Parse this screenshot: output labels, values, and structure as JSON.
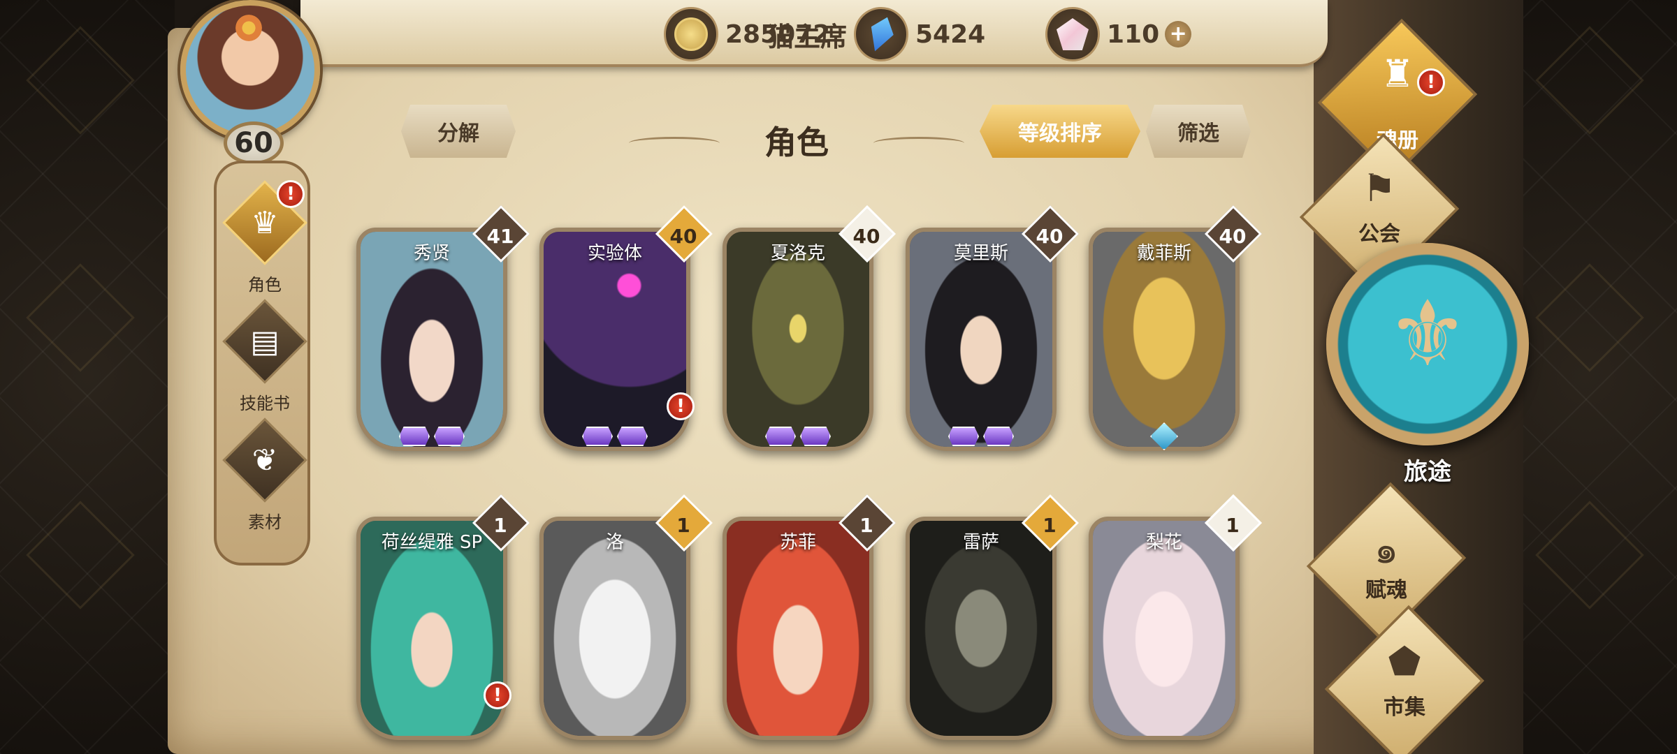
{
  "header": {
    "player_name": "猫主席",
    "player_level": "60",
    "currencies": [
      {
        "icon": "gold-coin-icon",
        "value": "285072"
      },
      {
        "icon": "blue-crystal-icon",
        "value": "5424"
      },
      {
        "icon": "pink-gem-icon",
        "value": "110"
      }
    ],
    "add_label": "+"
  },
  "left_nav": [
    {
      "label": "角色",
      "icon": "character-icon",
      "active": true,
      "alert": "!"
    },
    {
      "label": "技能书",
      "icon": "skill-book-icon",
      "active": false
    },
    {
      "label": "素材",
      "icon": "material-icon",
      "active": false
    }
  ],
  "toolbar": {
    "decompose_label": "分解",
    "title": "角色",
    "sort_label": "等级排序",
    "filter_label": "筛选"
  },
  "cards_row1": [
    {
      "name": "秀贤",
      "level": "41",
      "level_color": "#5a4535",
      "alert": ""
    },
    {
      "name": "实验体",
      "level": "40",
      "level_color": "#e4a93a",
      "alert": "!"
    },
    {
      "name": "夏洛克",
      "level": "40",
      "level_color": "#ffffff",
      "alert": ""
    },
    {
      "name": "莫里斯",
      "level": "40",
      "level_color": "#5a4535",
      "alert": ""
    },
    {
      "name": "戴菲斯",
      "level": "40",
      "level_color": "#5a4535",
      "alert": ""
    }
  ],
  "cards_row2": [
    {
      "name": "荷丝缇雅 SP",
      "level": "1",
      "level_color": "#5a4535",
      "alert": "!"
    },
    {
      "name": "洛",
      "level": "1",
      "level_color": "#e4a93a",
      "alert": ""
    },
    {
      "name": "苏菲",
      "level": "1",
      "level_color": "#5a4535",
      "alert": ""
    },
    {
      "name": "雷萨",
      "level": "1",
      "level_color": "#e4a93a",
      "alert": ""
    },
    {
      "name": "梨花",
      "level": "1",
      "level_color": "#ffffff",
      "alert": ""
    }
  ],
  "right_menu": [
    {
      "label": "魂册",
      "icon": "soul-book-icon",
      "alert": "!"
    },
    {
      "label": "公会",
      "icon": "guild-icon"
    },
    {
      "label": "旅途",
      "icon": "journey-icon"
    },
    {
      "label": "赋魂",
      "icon": "soul-fusion-icon"
    },
    {
      "label": "市集",
      "icon": "market-icon"
    }
  ],
  "colors": {
    "parchment": "#e6d6b2",
    "gold_accent": "#e4a93a",
    "alert_red": "#d9331e",
    "journey_teal": "#3cc0cf"
  }
}
